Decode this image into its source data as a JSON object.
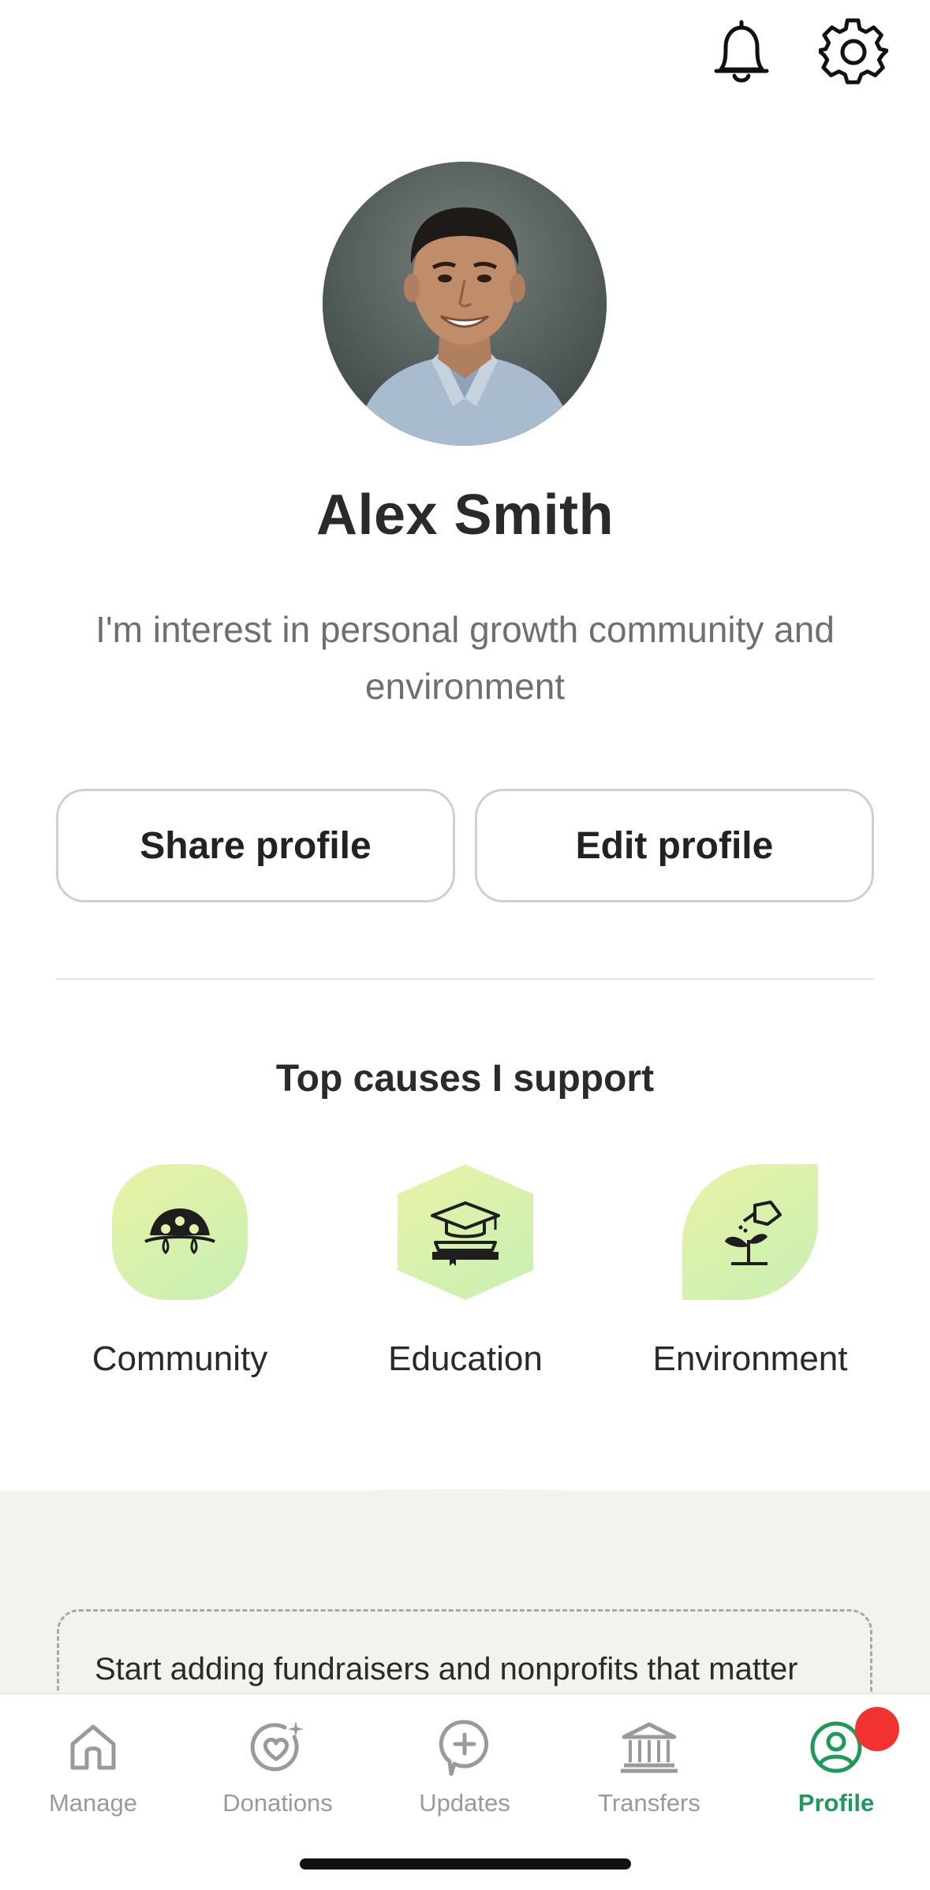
{
  "profile": {
    "name": "Alex Smith",
    "bio": "I'm interest in personal growth community and environment",
    "share_label": "Share profile",
    "edit_label": "Edit profile"
  },
  "causes": {
    "title": "Top causes I support",
    "items": [
      {
        "label": "Community",
        "icon": "community-icon"
      },
      {
        "label": "Education",
        "icon": "graduation-cap-icon"
      },
      {
        "label": "Environment",
        "icon": "watering-can-plant-icon"
      }
    ]
  },
  "prompt_card": {
    "text": "Start adding fundraisers and nonprofits that matter"
  },
  "tabbar": {
    "items": [
      {
        "label": "Manage",
        "icon": "home-icon"
      },
      {
        "label": "Donations",
        "icon": "heart-sparkle-icon"
      },
      {
        "label": "Updates",
        "icon": "chat-plus-icon"
      },
      {
        "label": "Transfers",
        "icon": "bank-icon"
      },
      {
        "label": "Profile",
        "icon": "user-circle-icon",
        "active": true
      }
    ]
  },
  "colors": {
    "accent_green": "#1f9a5a",
    "notification_red": "#f2322f",
    "beige": "#f3f2ec"
  }
}
